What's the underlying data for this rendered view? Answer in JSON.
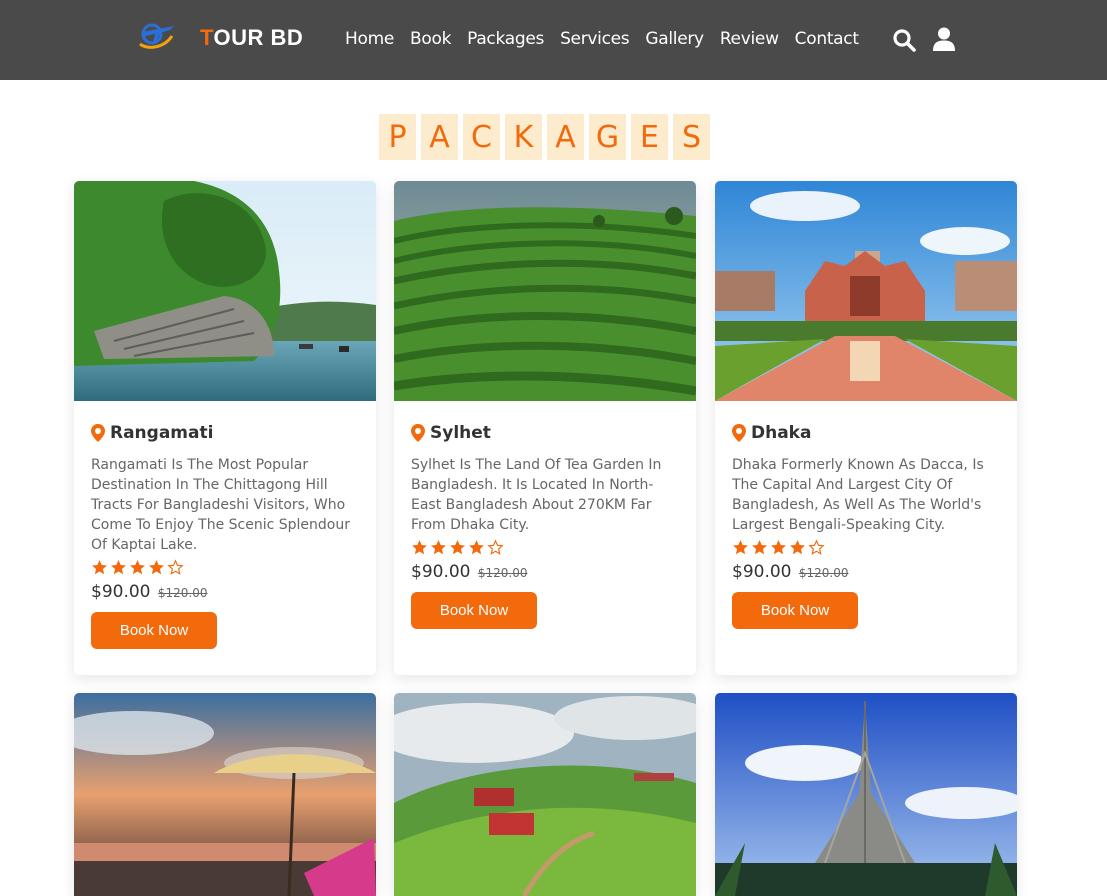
{
  "brand": {
    "first_letter": "T",
    "rest": "OUR BD"
  },
  "nav": {
    "items": [
      {
        "label": "Home"
      },
      {
        "label": "Book"
      },
      {
        "label": "Packages"
      },
      {
        "label": "Services"
      },
      {
        "label": "Gallery"
      },
      {
        "label": "Review"
      },
      {
        "label": "Contact"
      }
    ]
  },
  "icons": {
    "logo": "plane-globe-icon",
    "search": "search-icon",
    "user": "user-icon",
    "pin": "map-marker-icon",
    "star": "star-icon"
  },
  "colors": {
    "accent": "#f26a0c",
    "header_bg": "#4a4a4a",
    "heading_tile": "#fdebcd"
  },
  "heading": {
    "letters": [
      "P",
      "A",
      "C",
      "K",
      "A",
      "G",
      "E",
      "S"
    ]
  },
  "packages": [
    {
      "title": "Rangamati",
      "description": "Rangamati Is The Most Popular Destination In The Chittagong Hill Tracts For Bangladeshi Visitors, Who Come To Enjoy The Scenic Splendour Of Kaptai Lake.",
      "rating": 4,
      "max_rating": 5,
      "price": "$90.00",
      "old_price": "$120.00",
      "button": "Book Now"
    },
    {
      "title": "Sylhet",
      "description": "Sylhet Is The Land Of Tea Garden In Bangladesh. It Is Located In North-East Bangladesh About 270KM Far From Dhaka City.",
      "rating": 4,
      "max_rating": 5,
      "price": "$90.00",
      "old_price": "$120.00",
      "button": "Book Now"
    },
    {
      "title": "Dhaka",
      "description": "Dhaka Formerly Known As Dacca, Is The Capital And Largest City Of Bangladesh, As Well As The World's Largest Bengali-Speaking City.",
      "rating": 4,
      "max_rating": 5,
      "price": "$90.00",
      "old_price": "$120.00",
      "button": "Book Now"
    }
  ]
}
